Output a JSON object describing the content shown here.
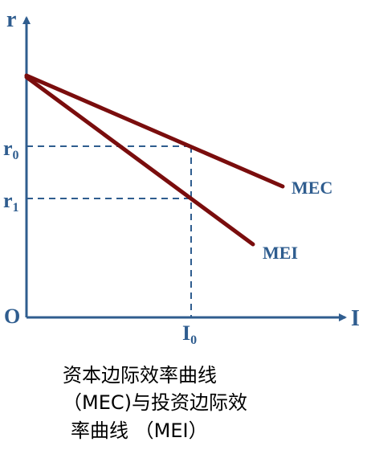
{
  "axes": {
    "y_label": "r",
    "x_label": "I",
    "origin_label": "O",
    "y_ticks": [
      {
        "base": "r",
        "sub": "0"
      },
      {
        "base": "r",
        "sub": "1"
      }
    ],
    "x_ticks": [
      {
        "base": "I",
        "sub": "0"
      }
    ]
  },
  "curves": {
    "mec": {
      "label": "MEC"
    },
    "mei": {
      "label": "MEI"
    }
  },
  "caption": {
    "line1": "资本边际效率曲线",
    "line2": "（MEC)与投资边际效",
    "line3": "率曲线 （MEI）"
  },
  "colors": {
    "axis": "#2f5d8f",
    "curve": "#7a0d0d",
    "guide": "#2f5d8f",
    "text": "#000000"
  }
}
